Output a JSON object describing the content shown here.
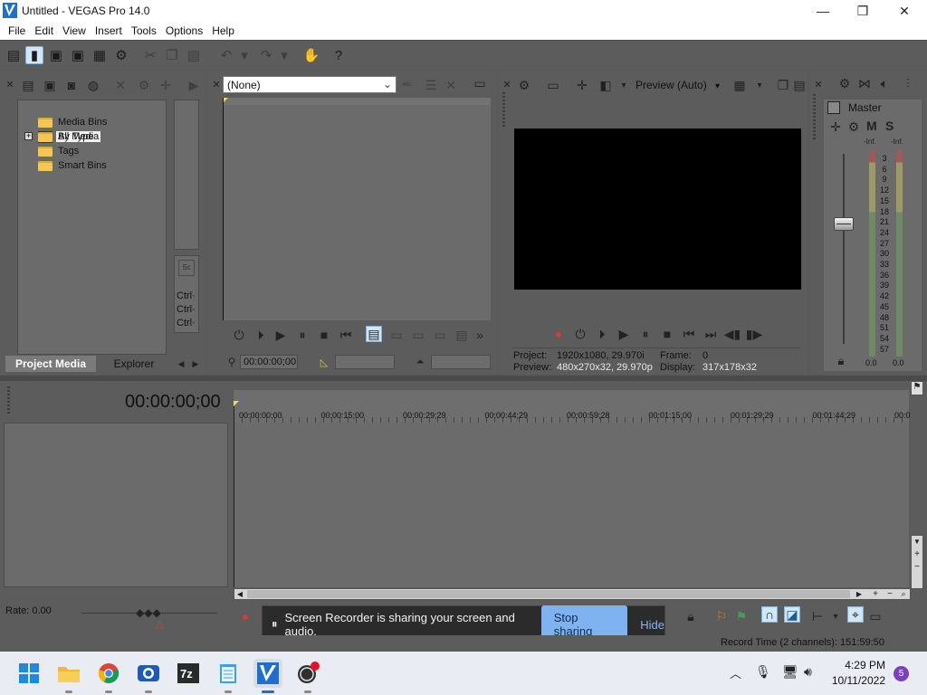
{
  "window": {
    "title": "Untitled - VEGAS Pro 14.0",
    "minimize_glyph": "—",
    "maximize_glyph": "❐",
    "close_glyph": "✕"
  },
  "menu": [
    "File",
    "Edit",
    "View",
    "Insert",
    "Tools",
    "Options",
    "Help"
  ],
  "project_media": {
    "tree": [
      "All Media",
      "Media Bins",
      "By Type",
      "Tags",
      "Smart Bins"
    ],
    "side_labels": [
      "Ctrl·",
      "Ctrl·",
      "Ctrl·"
    ],
    "tabs": [
      "Project Media",
      "Explorer"
    ]
  },
  "trimmer": {
    "dropdown_value": "(None)",
    "timecode": "00:00:00;00"
  },
  "preview": {
    "mode_label": "Preview (Auto)",
    "project_label": "Project:",
    "project_value": "1920x1080, 29.970i",
    "preview_label": "Preview:",
    "preview_value": "480x270x32, 29.970p",
    "frame_label": "Frame:",
    "frame_value": "0",
    "display_label": "Display:",
    "display_value": "317x178x32"
  },
  "master_bus": {
    "title": "Master",
    "m_label": "M",
    "s_label": "S",
    "peak_left": "-Inf.",
    "peak_right": "-Inf.",
    "scale": [
      "3",
      "6",
      "9",
      "12",
      "15",
      "18",
      "21",
      "24",
      "27",
      "30",
      "33",
      "36",
      "39",
      "42",
      "45",
      "48",
      "51",
      "54",
      "57"
    ],
    "level_left": "0.0",
    "level_right": "0.0"
  },
  "timeline": {
    "timecode": "00:00:00;00",
    "ruler": [
      "00:00:00;00",
      "00:00:15;00",
      "00:00:29;29",
      "00:00:44;29",
      "00:00:59;28",
      "00:01:15;00",
      "00:01:29;29",
      "00:01:44;29",
      "00:0"
    ],
    "rate_label": "Rate: 0.00"
  },
  "notification": {
    "text": "Screen Recorder is sharing your screen and audio.",
    "stop_label": "Stop sharing",
    "hide_label": "Hide"
  },
  "status": {
    "record_time": "Record Time (2 channels): 151:59:50"
  },
  "taskbar": {
    "time": "4:29 PM",
    "date": "10/11/2022",
    "notification_count": "5",
    "apps": [
      "start-icon",
      "file-explorer-icon",
      "chrome-icon",
      "camera-icon",
      "7zip-icon",
      "notepad-icon",
      "vegas-icon",
      "obs-icon"
    ]
  },
  "colors": {
    "accent_blue": "#7fb2f1",
    "folder_yellow": "#f5c651",
    "panel_gray": "#5c5c5c"
  }
}
